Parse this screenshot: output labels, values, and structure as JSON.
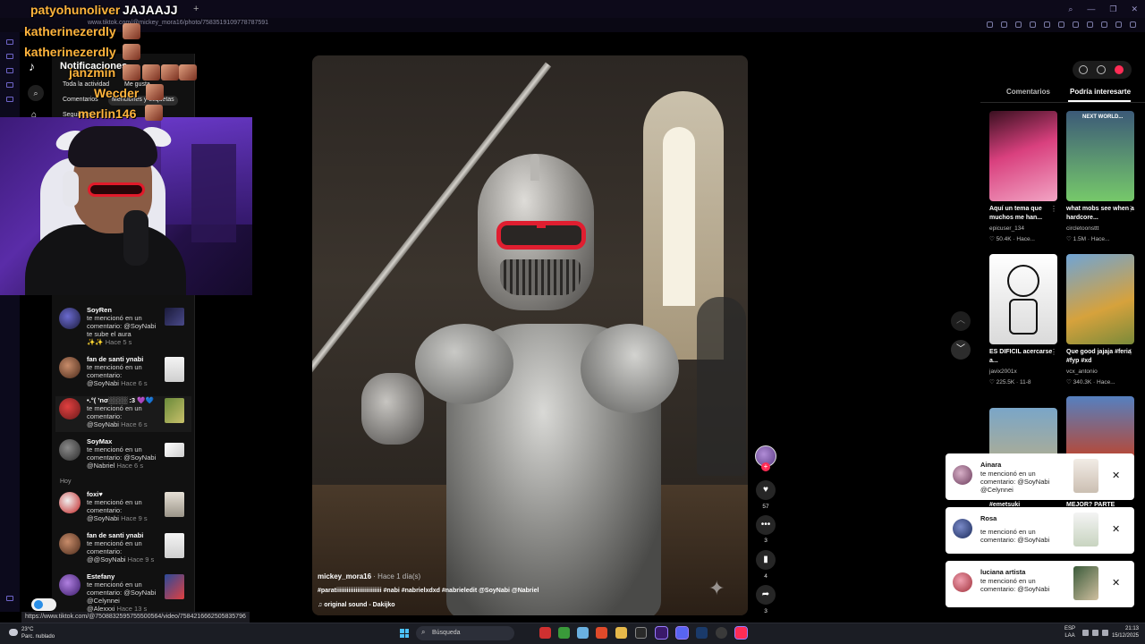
{
  "browser": {
    "url": "www.tiktok.com/@mickey_mora16/photo/7583519109778787591",
    "status_url": "https://www.tiktok.com/@750883259575550056​4/video/7584216662505835796",
    "new_tab": "+"
  },
  "overlay_chat": [
    {
      "user": "patyohunoliver",
      "message": "JAJAAJJ"
    },
    {
      "user": "katherinezerdly",
      "message": ""
    },
    {
      "user": "katherinezerdly",
      "message": ""
    },
    {
      "user": "janzmin",
      "message": ""
    },
    {
      "user": "Wecder",
      "message": ""
    },
    {
      "user": "merlin146",
      "message": ""
    }
  ],
  "notifications": {
    "title": "Notificaciones",
    "filters": [
      "Toda la actividad",
      "Me gusta",
      "Comentarios",
      "Menciones y etiquetas",
      "Seguidores"
    ],
    "section_today": "Hoy",
    "items": [
      {
        "name": "SoyRen",
        "lines": [
          "te mencionó en un",
          "comentario: @SoyNabi",
          "te sube el aura"
        ],
        "time": "✨✨ Hace 5 s"
      },
      {
        "name": "fan de santi ynabi",
        "lines": [
          "te mencionó en un",
          "comentario:"
        ],
        "time_prefix": "@SoyNabi",
        "time": "Hace 6 s"
      },
      {
        "name": "•.°( ʼnσ░░░░ :3 💜💙",
        "lines": [
          "te mencionó en un",
          "comentario:"
        ],
        "time_prefix": "@SoyNabi",
        "time": "Hace 6 s"
      },
      {
        "name": "SoyMax",
        "lines": [
          "te mencionó en un",
          "comentario: @SoyNabi"
        ],
        "time_prefix": "@Nabriel",
        "time": "Hace 6 s"
      },
      {
        "name": "foxi♥",
        "lines": [
          "te mencionó en un",
          "comentario:"
        ],
        "time_prefix": "@SoyNabi",
        "time": "Hace 9 s"
      },
      {
        "name": "fan de santi ynabi",
        "lines": [
          "te mencionó en un",
          "comentario:"
        ],
        "time_prefix": "@@SoyNabi",
        "time": "Hace 9 s"
      },
      {
        "name": "Estefany",
        "lines": [
          "te mencionó en un",
          "comentario: @SoyNabi",
          "@Celynnei"
        ],
        "time_prefix": "@Alexxxi",
        "time": "Hace 13 s"
      }
    ]
  },
  "video": {
    "username": "mickey_mora16",
    "posted": "· Hace 1 día(s)",
    "caption": "#paratiiiiiiiiiiiiiiiiiiiiiiiiii #nabi #nabrielxdxd #nabrieledit @SoyNabi @Nabriel",
    "sound": "♫  original sound - Dakijko",
    "likes": "57",
    "comments": "3",
    "saves": "4",
    "shares": "3"
  },
  "right_panel": {
    "tabs": [
      "Comentarios",
      "Podría interesarte"
    ],
    "active_tab": 1,
    "cards": [
      {
        "title": "Aquí un tema que muchos me han...",
        "author": "epicuser_134",
        "stats": "♡ 50.4K · Hace...",
        "colors": [
          "#d9407e",
          "#f2a4c4"
        ]
      },
      {
        "title": "what mobs see when a hardcore...",
        "author": "circletoonsttt",
        "stats": "♡ 1.5M · Hace...",
        "colors": [
          "#3c5a78",
          "#76c96a"
        ],
        "overlay_text": "NEXT WORLD..."
      },
      {
        "title": "ES DIFICIL acercarse a...",
        "author": "javix2001x",
        "stats": "♡ 225.5K · 11-8",
        "colors": [
          "#ffffff",
          "#dadada"
        ]
      },
      {
        "title": "Que good jajaja #feria #fyp #xd",
        "author": "vcx_antonio",
        "stats": "♡ 340.3K · Hace...",
        "colors": [
          "#6fa4d6",
          "#d6a23c"
        ]
      },
      {
        "title": "#emetsuki",
        "author": "",
        "stats": "",
        "colors": [
          "#c7b07a",
          "#7aa6c8"
        ]
      },
      {
        "title": "MEJOR? PARTE",
        "author": "",
        "stats": "",
        "colors": [
          "#5580c0",
          "#b44a3a"
        ]
      }
    ]
  },
  "toasts": [
    {
      "name": "Ainara",
      "lines": [
        "te mencionó en un",
        "comentario: @SoyNabi",
        "@Celynnei"
      ],
      "close": "✕"
    },
    {
      "name": "Rosa",
      "lines": [
        "te mencionó en un",
        "comentario: @SoyNabi"
      ],
      "close": "✕"
    },
    {
      "name": "luciana artista",
      "lines": [
        "te mencionó en un",
        "comentario: @SoyNabi"
      ],
      "close": "✕"
    }
  ],
  "taskbar": {
    "weather_temp": "23°C",
    "weather_desc": "Parc. nublado",
    "search_placeholder": "Búsqueda",
    "lang1": "ESP",
    "lang2": "LAA",
    "time": "21:13",
    "date": "15/12/2025"
  },
  "colors": {
    "accent": "#fe2c55",
    "overlay_user": "#ffb43c",
    "windows_blue": "#4cc2ff"
  }
}
